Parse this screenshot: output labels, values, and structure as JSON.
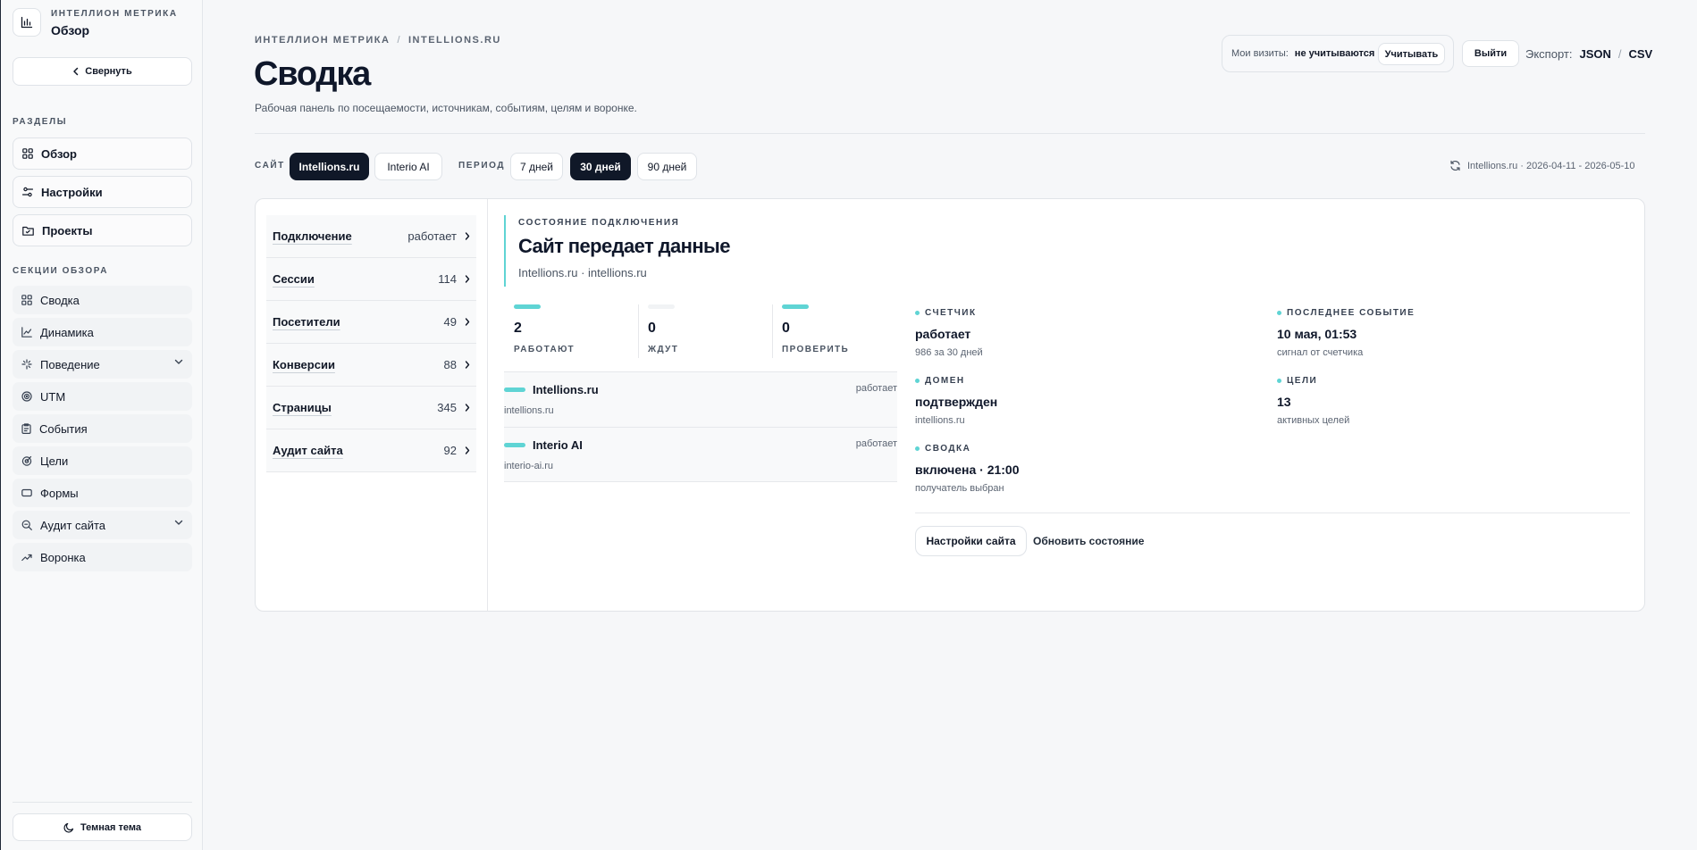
{
  "sidebar": {
    "brand_kicker": "ИНТЕЛЛИОН МЕТРИКА",
    "brand_title": "Обзор",
    "collapse_label": "Свернуть",
    "sections_label": "РАЗДЕЛЫ",
    "nav": [
      {
        "label": "Обзор",
        "icon": "grid-icon"
      },
      {
        "label": "Настройки",
        "icon": "sliders-icon"
      },
      {
        "label": "Проекты",
        "icon": "folder-icon"
      }
    ],
    "overview_sections_label": "СЕКЦИИ ОБЗОРА",
    "sections": [
      {
        "label": "Сводка",
        "icon": "grid-icon"
      },
      {
        "label": "Динамика",
        "icon": "line-chart-icon"
      },
      {
        "label": "Поведение",
        "icon": "sparkle-icon",
        "expandable": true
      },
      {
        "label": "UTM",
        "icon": "target-icon"
      },
      {
        "label": "События",
        "icon": "clipboard-icon"
      },
      {
        "label": "Цели",
        "icon": "goal-icon"
      },
      {
        "label": "Формы",
        "icon": "form-icon"
      },
      {
        "label": "Аудит сайта",
        "icon": "search-icon",
        "expandable": true
      },
      {
        "label": "Воронка",
        "icon": "trend-icon"
      }
    ],
    "theme_label": "Темная тема"
  },
  "header": {
    "breadcrumb": [
      "ИНТЕЛЛИОН МЕТРИКА",
      "INTELLIONS.RU"
    ],
    "breadcrumb_sep": "/",
    "title": "Сводка",
    "subtitle": "Рабочая панель по посещаемости, источникам, событиям, целям и воронке.",
    "my_visits_label": "Мои визиты:",
    "my_visits_value": "не учитываются",
    "count_button": "Учитывать",
    "logout_button": "Выйти",
    "export_label": "Экспорт:",
    "export_json": "JSON",
    "export_csv": "CSV",
    "export_sep": "/"
  },
  "filters": {
    "site_label": "САЙТ",
    "sites": [
      "Intellions.ru",
      "Interio AI"
    ],
    "active_site": "Intellions.ru",
    "period_label": "ПЕРИОД",
    "periods": [
      "7 дней",
      "30 дней",
      "90 дней"
    ],
    "active_period": "30 дней",
    "range_text": "Intellions.ru · 2026-04-11 - 2026-05-10"
  },
  "metrics": [
    {
      "name": "Подключение",
      "value": "работает"
    },
    {
      "name": "Сессии",
      "value": "114"
    },
    {
      "name": "Посетители",
      "value": "49"
    },
    {
      "name": "Конверсии",
      "value": "88"
    },
    {
      "name": "Страницы",
      "value": "345"
    },
    {
      "name": "Аудит сайта",
      "value": "92"
    }
  ],
  "connection": {
    "kicker": "СОСТОЯНИЕ ПОДКЛЮЧЕНИЯ",
    "title": "Сайт передает данные",
    "subtitle": "Intellions.ru · intellions.ru",
    "stats": [
      {
        "value": "2",
        "label": "РАБОТАЮТ",
        "color": "#5fd4d4"
      },
      {
        "value": "0",
        "label": "ЖДУТ",
        "color": "#f1f3f5"
      },
      {
        "value": "0",
        "label": "ПРОВЕРИТЬ",
        "color": "#5fd4d4"
      }
    ],
    "sites": [
      {
        "name": "Intellions.ru",
        "host": "intellions.ru",
        "status": "работает"
      },
      {
        "name": "Interio AI",
        "host": "interio-ai.ru",
        "status": "работает"
      }
    ],
    "details": {
      "counter": {
        "key": "СЧЕТЧИК",
        "value": "работает",
        "sub": "986 за 30 дней"
      },
      "last_event": {
        "key": "ПОСЛЕДНЕЕ СОБЫТИЕ",
        "value": "10 мая, 01:53",
        "sub": "сигнал от счетчика"
      },
      "domain": {
        "key": "ДОМЕН",
        "value": "подтвержден",
        "sub": "intellions.ru"
      },
      "goals": {
        "key": "ЦЕЛИ",
        "value": "13",
        "sub": "активных целей"
      },
      "summary": {
        "key": "СВОДКА",
        "value": "включена · 21:00",
        "sub": "получатель выбран"
      }
    },
    "settings_button": "Настройки сайта",
    "refresh_link": "Обновить состояние",
    "accent": "#5fd4d4"
  }
}
